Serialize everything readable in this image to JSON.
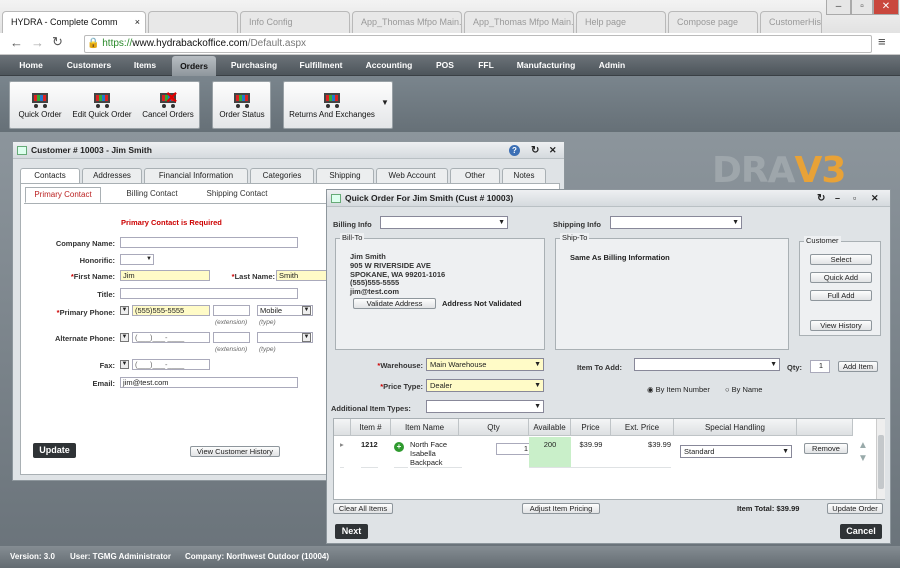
{
  "browser": {
    "tabs": [
      {
        "label": "HYDRA - Complete Comm",
        "active": true
      },
      {
        "label": "",
        "active": false
      },
      {
        "label": "Info Config",
        "active": false
      },
      {
        "label": "App_Thomas Mfpo Main.us",
        "active": false
      },
      {
        "label": "App_Thomas Mfpo Main.us",
        "active": false
      },
      {
        "label": "Help page",
        "active": false
      },
      {
        "label": "Compose page",
        "active": false
      },
      {
        "label": "CustomerHistory.aspx",
        "active": false
      }
    ],
    "url_prefix": "https://",
    "url_host": "www.hydrabackoffice.com",
    "url_path": "/Default.aspx",
    "tab_close": "×"
  },
  "nav": {
    "items": [
      "Home",
      "Customers",
      "Items",
      "Orders",
      "Purchasing",
      "Fulfillment",
      "Accounting",
      "POS",
      "FFL",
      "Manufacturing",
      "Admin"
    ],
    "active": "Orders"
  },
  "ribbon": {
    "group1": [
      "Quick Order",
      "Edit Quick Order",
      "Cancel Orders"
    ],
    "group2": [
      "Order Status"
    ],
    "group3": [
      "Returns And Exchanges"
    ]
  },
  "logo": {
    "text1": "DRA",
    "text2": "V3"
  },
  "customer_window": {
    "title": "Customer # 10003 - Jim Smith",
    "tabs": [
      "Contacts",
      "Addresses",
      "Financial Information",
      "Categories",
      "Shipping",
      "Web Account",
      "Other",
      "Notes"
    ],
    "subtabs": [
      "Primary Contact",
      "Billing Contact",
      "Shipping Contact"
    ],
    "required_msg": "Primary Contact is Required",
    "labels": {
      "company": "Company Name:",
      "honorific": "Honorific:",
      "first": "First Name:",
      "last": "Last Name:",
      "title": "Title:",
      "primary_phone": "Primary Phone:",
      "alt_phone": "Alternate Phone:",
      "fax": "Fax:",
      "email": "Email:"
    },
    "values": {
      "first": "Jim",
      "last": "Smith",
      "primary_phone": "(555)555-5555",
      "phone_type": "Mobile",
      "alt_phone": "(___)___-____",
      "fax": "(___)___-____",
      "email": "jim@test.com"
    },
    "hints": {
      "extension": "(extension)",
      "type": "(type)"
    },
    "asterisk": "*",
    "update_btn": "Update",
    "history_btn": "View Customer History"
  },
  "quick_order": {
    "title": "Quick Order For Jim Smith (Cust # 10003)",
    "billing_info": "Billing Info",
    "shipping_info": "Shipping Info",
    "bill_to": {
      "legend": "Bill-To",
      "lines": [
        "Jim Smith",
        "905 W RIVERSIDE AVE",
        "SPOKANE, WA 99201-1016",
        "(555)555-5555",
        "jim@test.com"
      ],
      "validate_btn": "Validate Address",
      "status": "Address Not Validated"
    },
    "ship_to": {
      "legend": "Ship-To",
      "text": "Same As Billing Information"
    },
    "customer_box": {
      "legend": "Customer",
      "buttons": [
        "Select",
        "Quick Add",
        "Full Add",
        "View History"
      ]
    },
    "warehouse_label": "Warehouse:",
    "warehouse": "Main Warehouse",
    "price_type_label": "Price Type:",
    "price_type": "Dealer",
    "additional_label": "Additional Item Types:",
    "item_to_add": "Item To Add:",
    "qty_label": "Qty:",
    "qty_value": "1",
    "add_item": "Add Item",
    "radio1": "By Item Number",
    "radio2": "By Name",
    "grid": {
      "headers": [
        "Item #",
        "Item Name",
        "Qty",
        "Available",
        "Price",
        "Ext. Price",
        "Special Handling"
      ],
      "rows": [
        {
          "item": "1212",
          "name": "North Face Isabella Backpack",
          "qty": "1",
          "available": "200",
          "price": "$39.99",
          "ext": "$39.99",
          "handling": "Standard",
          "remove": "Remove"
        }
      ]
    },
    "clear_btn": "Clear All Items",
    "adjust_btn": "Adjust Item Pricing",
    "item_total_label": "Item Total:",
    "item_total": "$39.99",
    "update_order": "Update Order",
    "next_btn": "Next",
    "cancel_btn": "Cancel"
  },
  "status": {
    "version": "Version: 3.0",
    "user": "User: TGMG Administrator",
    "company": "Company: Northwest Outdoor (10004)"
  },
  "colors": {
    "accent": "#e8a237",
    "nav": "#555d63",
    "required": "#cc0000",
    "yellow_field": "#fffbc7"
  }
}
